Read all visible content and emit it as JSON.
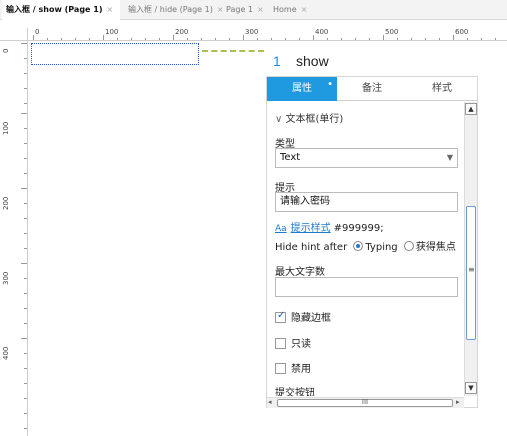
{
  "tabs": [
    {
      "label": "输入框 / show (Page 1)",
      "close": "×"
    },
    {
      "label": "输入框 / hide (Page 1)",
      "close": "×"
    },
    {
      "label": "Page 1",
      "close": "×"
    },
    {
      "label": "Home",
      "close": "×"
    }
  ],
  "ruler": {
    "h": [
      "0",
      "100",
      "200",
      "300",
      "400",
      "500",
      "600"
    ],
    "v": [
      "0",
      "100",
      "200",
      "300",
      "400"
    ]
  },
  "note": {
    "number": "1",
    "title": "show"
  },
  "panel": {
    "tabs": [
      "属性",
      "备注",
      "样式"
    ],
    "active_dot": "•",
    "section": "文本框(单行)",
    "type_label": "类型",
    "type_value": "Text",
    "hint_label": "提示",
    "hint_value": "请输入密码",
    "hint_style_icon": "Aa",
    "hint_style_link": "提示样式",
    "hint_color": "#999999;",
    "hide_hint_label": "Hide hint after",
    "option_typing": "Typing",
    "option_focus": "获得焦点",
    "maxlen_label": "最大文字数",
    "maxlen_value": "",
    "chk_hide_border": "隐藏边框",
    "chk_readonly": "只读",
    "chk_disabled": "禁用",
    "submit_label": "提交按钮",
    "scroll_grip": "≡",
    "hscroll_grip": "III"
  }
}
